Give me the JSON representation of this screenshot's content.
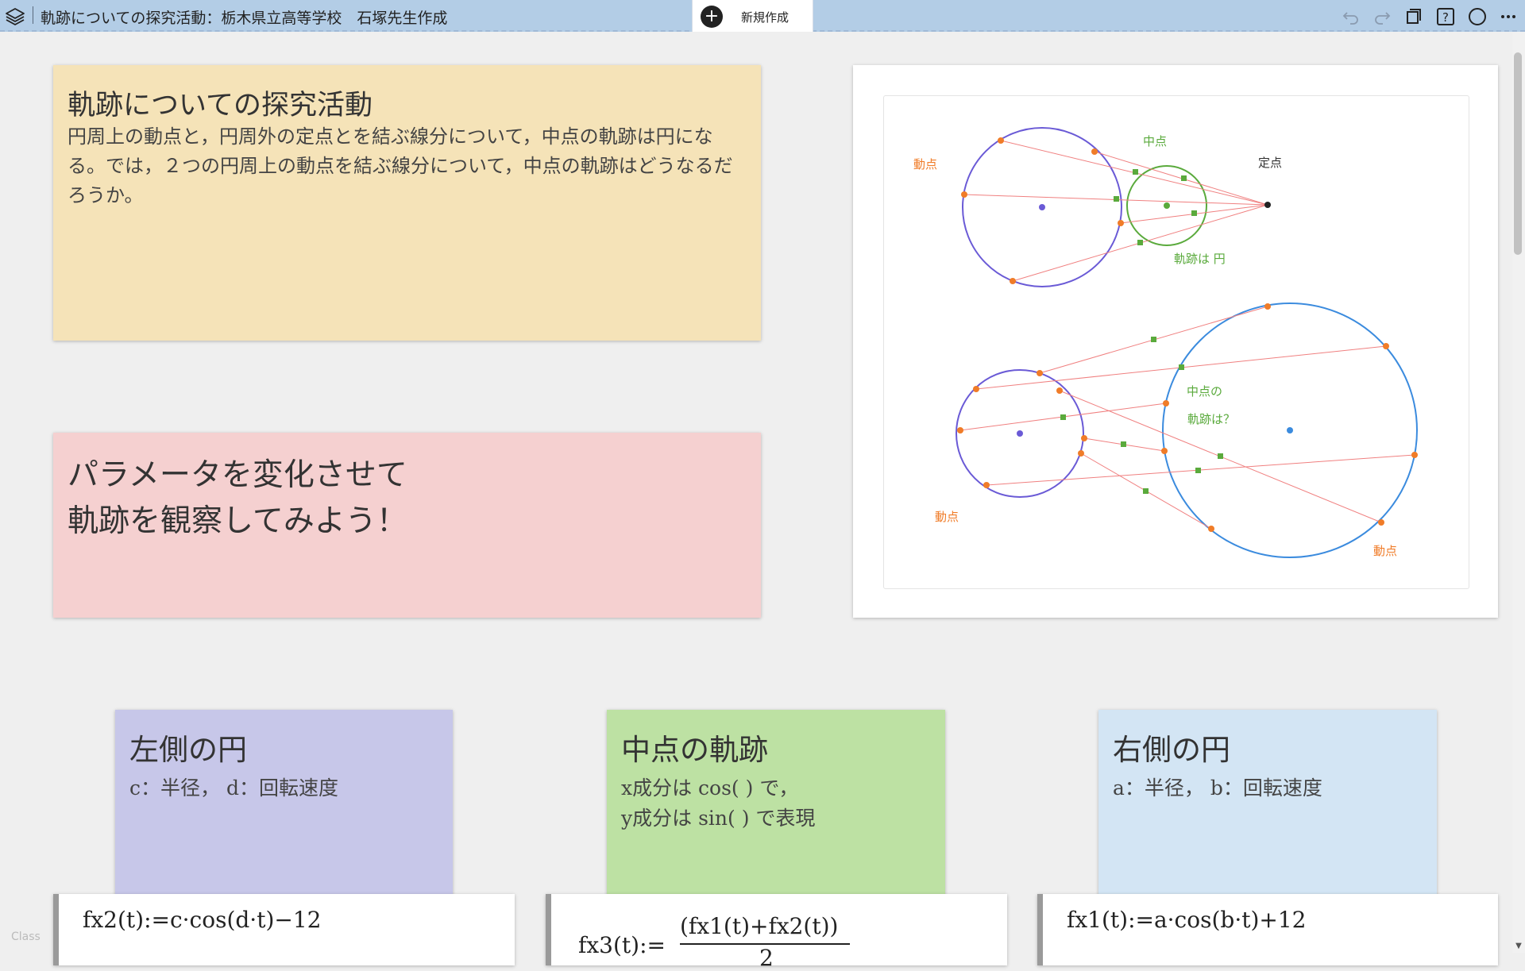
{
  "header": {
    "title": "軌跡についての探究活動：栃木県立高等学校　石塚先生作成",
    "new_tab_label": "新規作成",
    "icons": [
      "layers-icon",
      "undo-icon",
      "redo-icon",
      "pages-icon",
      "help-icon",
      "circle-icon",
      "more-icon"
    ]
  },
  "cards": {
    "intro": {
      "title": "軌跡についての探究活動",
      "text": "円周上の動点と，円周外の定点とを結ぶ線分について，中点の軌跡は円になる。では，２つの円周上の動点を結ぶ線分について，中点の軌跡はどうなるだろうか。"
    },
    "prompt": {
      "line1": "パラメータを変化させて",
      "line2": "軌跡を観察してみよう！"
    },
    "left_circle": {
      "title": "左側の円",
      "text": "c：半径， d：回転速度"
    },
    "midpoint": {
      "title": "中点の軌跡",
      "line1": "x成分は cos( ) で，",
      "line2": "y成分は sin( ) で表現"
    },
    "right_circle": {
      "title": "右側の円",
      "text": "a：半径， b：回転速度"
    }
  },
  "graph": {
    "labels": {
      "moving_point": "動点",
      "midpoint": "中点",
      "fixed_point": "定点",
      "locus_circle": "軌跡は 円",
      "locus_q1": "中点の",
      "locus_q2": "軌跡は？"
    },
    "colors": {
      "orange": "#f07c28",
      "green": "#5aaa3c",
      "purple": "#6a5ad6",
      "blue": "#3b8bde",
      "red": "#f08080"
    }
  },
  "formulas": {
    "fx2": "fx2(t):=c·cos(d·t)−12",
    "fx3_name": "fx3(t):=",
    "fx3_num": "(fx1(t)+fx2(t))",
    "fx3_den": "2",
    "fx1": "fx1(t):=a·cos(b·t)+12"
  },
  "footer": {
    "tag": "Class"
  }
}
